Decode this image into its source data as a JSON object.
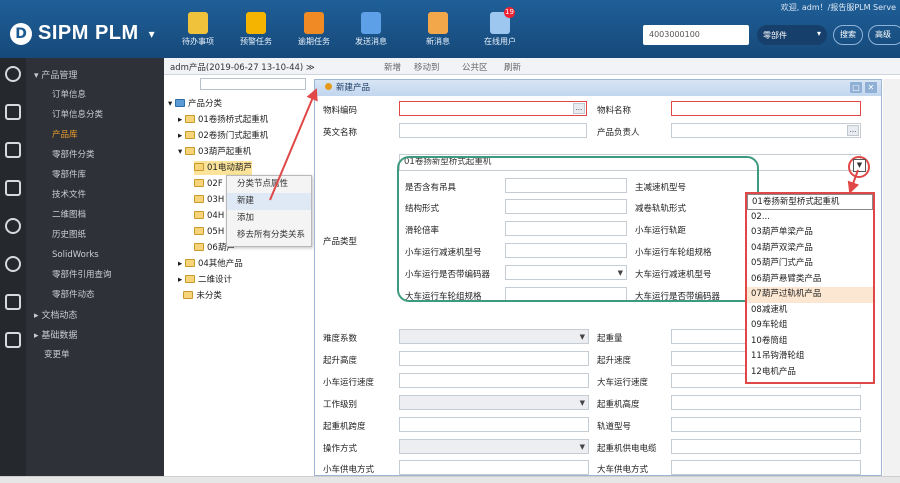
{
  "header": {
    "welcome": "欢迎, adm！/报告服PLM  Serve",
    "app_name": "SIPM PLM",
    "tools": [
      {
        "label": "待办事项",
        "icon": "todo-icon",
        "color": "#f0c23b"
      },
      {
        "label": "预警任务",
        "icon": "warning-task-icon",
        "color": "#f4b400"
      },
      {
        "label": "逾期任务",
        "icon": "overdue-task-icon",
        "color": "#f08a24"
      },
      {
        "label": "发送消息",
        "icon": "send-message-icon",
        "color": "#5ea0e8"
      },
      {
        "label": "新消息",
        "icon": "new-message-icon",
        "color": "#f2a74a"
      },
      {
        "label": "在线用户",
        "icon": "online-users-icon",
        "color": "#9ec7f0",
        "badge": "19"
      }
    ],
    "search_value": "4003000100",
    "search_type": "零部件",
    "search_btn": "搜索",
    "adv_btn": "高级"
  },
  "nav": {
    "group_product": "产品管理",
    "items": [
      "订单信息",
      "订单信息分类",
      "产品库",
      "零部件分类",
      "零部件库",
      "技术文件",
      "二维图档",
      "历史图纸",
      "SolidWorks",
      "零部件引用查询",
      "零部件动态"
    ],
    "active": "产品库",
    "group_docs": "文档动态",
    "group_base": "基础数据",
    "change_order": "变更单"
  },
  "tree_header": {
    "crumb": "adm产品(2019-06-27 13-10-44)  ≫",
    "btn_new": "新增",
    "btn_move": "移动到",
    "btn_public": "公共区",
    "btn_refresh": "刷新"
  },
  "tree": {
    "root": "产品分类",
    "n1": "01卷扬桥式起重机",
    "n2": "02卷扬门式起重机",
    "n3": "03葫芦起重机",
    "c1": "01电动葫芦",
    "c2": "02F",
    "c3": "03H",
    "c4": "04H",
    "c5": "05H",
    "c6": "06葫芦",
    "n4": "04其他产品",
    "n5": "二维设计",
    "n6": "未分类"
  },
  "context_menu": [
    "分类节点属性",
    "新建",
    "添加",
    "移去所有分类关系"
  ],
  "form": {
    "title": "新建产品",
    "material_code": "物料编码",
    "material_name": "物料名称",
    "english_name": "英文名称",
    "owner": "产品负责人",
    "product_type": "产品类型",
    "type_value": "01卷扬新型桥式起重机",
    "attrs_left": [
      "是否含有吊具",
      "结构形式",
      "滑轮倍率",
      "小车运行减速机型号",
      "小车运行是否带编码器",
      "大车运行车轮组规格"
    ],
    "attrs_right": [
      "主减速机型号",
      "减卷轨轨形式",
      "小车运行轨距",
      "小车运行车轮组规格",
      "大车运行减速机型号",
      "大车运行是否带编码器"
    ],
    "rows_left": [
      "难度系数",
      "起升高度",
      "小车运行速度",
      "工作级别",
      "起重机跨度",
      "操作方式",
      "小车供电方式"
    ],
    "rows_right": [
      "起重量",
      "起升速度",
      "大车运行速度",
      "起重机高度",
      "轨道型号",
      "起重机供电电缆",
      "大车供电方式"
    ]
  },
  "dropdown": {
    "options": [
      "01卷扬新型桥式起重机",
      "02...",
      "03葫芦单梁产品",
      "04葫芦双梁产品",
      "05葫芦门式产品",
      "06葫芦悬臂类产品",
      "07葫芦过轨机产品",
      "08减速机",
      "09车轮组",
      "10卷筒组",
      "11吊钩滑轮组",
      "12电机产品"
    ],
    "highlighted": "07葫芦过轨机产品"
  }
}
